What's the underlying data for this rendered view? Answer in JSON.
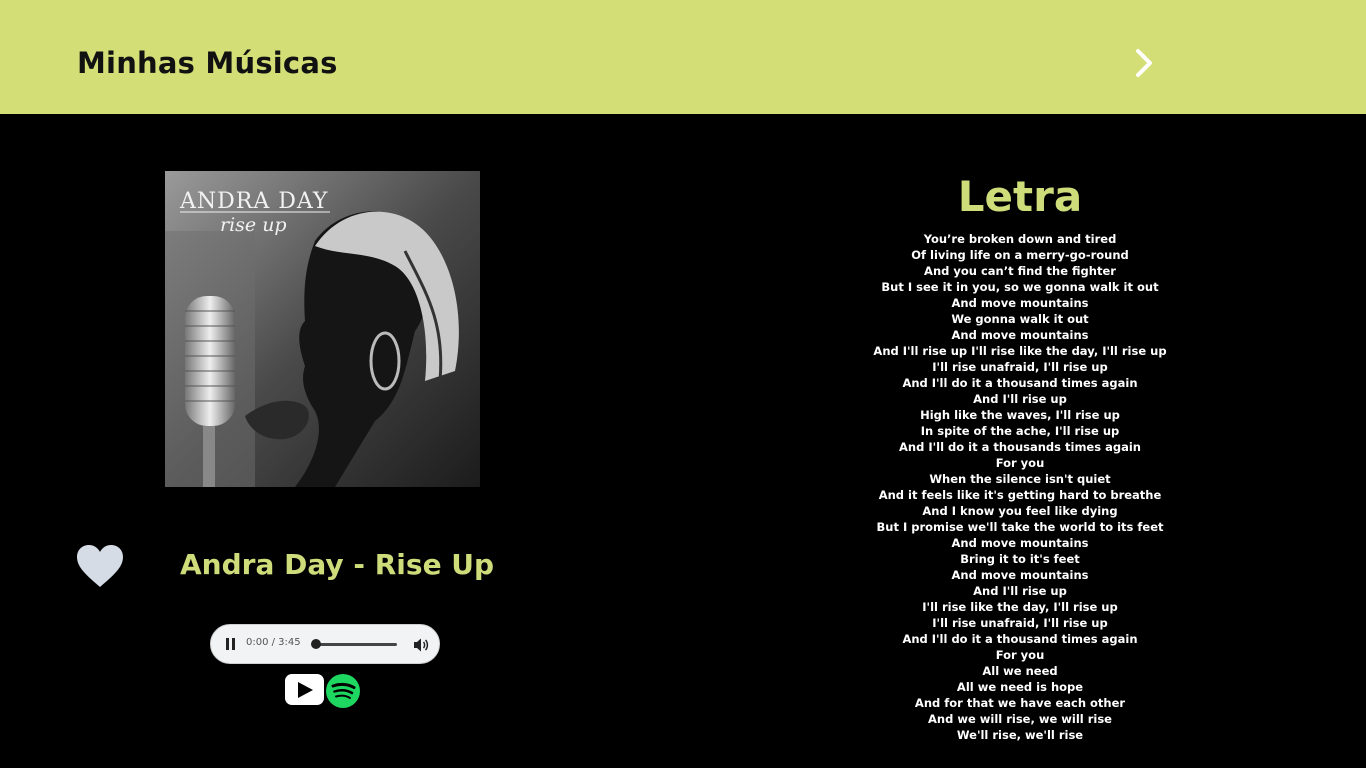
{
  "header": {
    "title": "Minhas Músicas",
    "next_icon": "chevron-right-icon"
  },
  "song": {
    "title": "Andra Day - Rise Up",
    "cover_artist": "ANDRA DAY",
    "cover_album": "rise up",
    "favorite_icon": "heart-icon"
  },
  "player": {
    "time": "0:00 / 3:45",
    "progress": 0
  },
  "links": {
    "youtube_icon": "youtube-icon",
    "spotify_icon": "spotify-icon"
  },
  "lyrics": {
    "heading": "Letra",
    "lines": [
      "You’re broken down and tired",
      "Of living life on a merry-go-round",
      "And you can’t find the fighter",
      "But I see it in you, so we gonna walk it out",
      "And move mountains",
      "We gonna walk it out",
      "And move mountains",
      "And I'll rise up I'll rise like the day, I'll rise up",
      "I'll rise unafraid, I'll rise up",
      "And I'll do it a thousand times again",
      "And I'll rise up",
      "High like the waves, I'll rise up",
      "In spite of the ache, I'll rise up",
      "And I'll do it a thousands times again",
      "For you",
      "When the silence isn't quiet",
      "And it feels like it's getting hard to breathe",
      "And I know you feel like dying",
      "But I promise we'll take the world to its feet",
      "And move mountains",
      "Bring it to it's feet",
      "And move mountains",
      "And I'll rise up",
      "I'll rise like the day, I'll rise up",
      "I'll rise unafraid, I'll rise up",
      "And I'll do it a thousand times again",
      "For you",
      "All we need",
      "All we need is hope",
      "And for that we have each other",
      "And we will rise, we will rise",
      "We'll rise, we'll rise"
    ]
  },
  "colors": {
    "accent": "#d4de76",
    "title_text": "#cfdc7a",
    "background": "#000000"
  }
}
